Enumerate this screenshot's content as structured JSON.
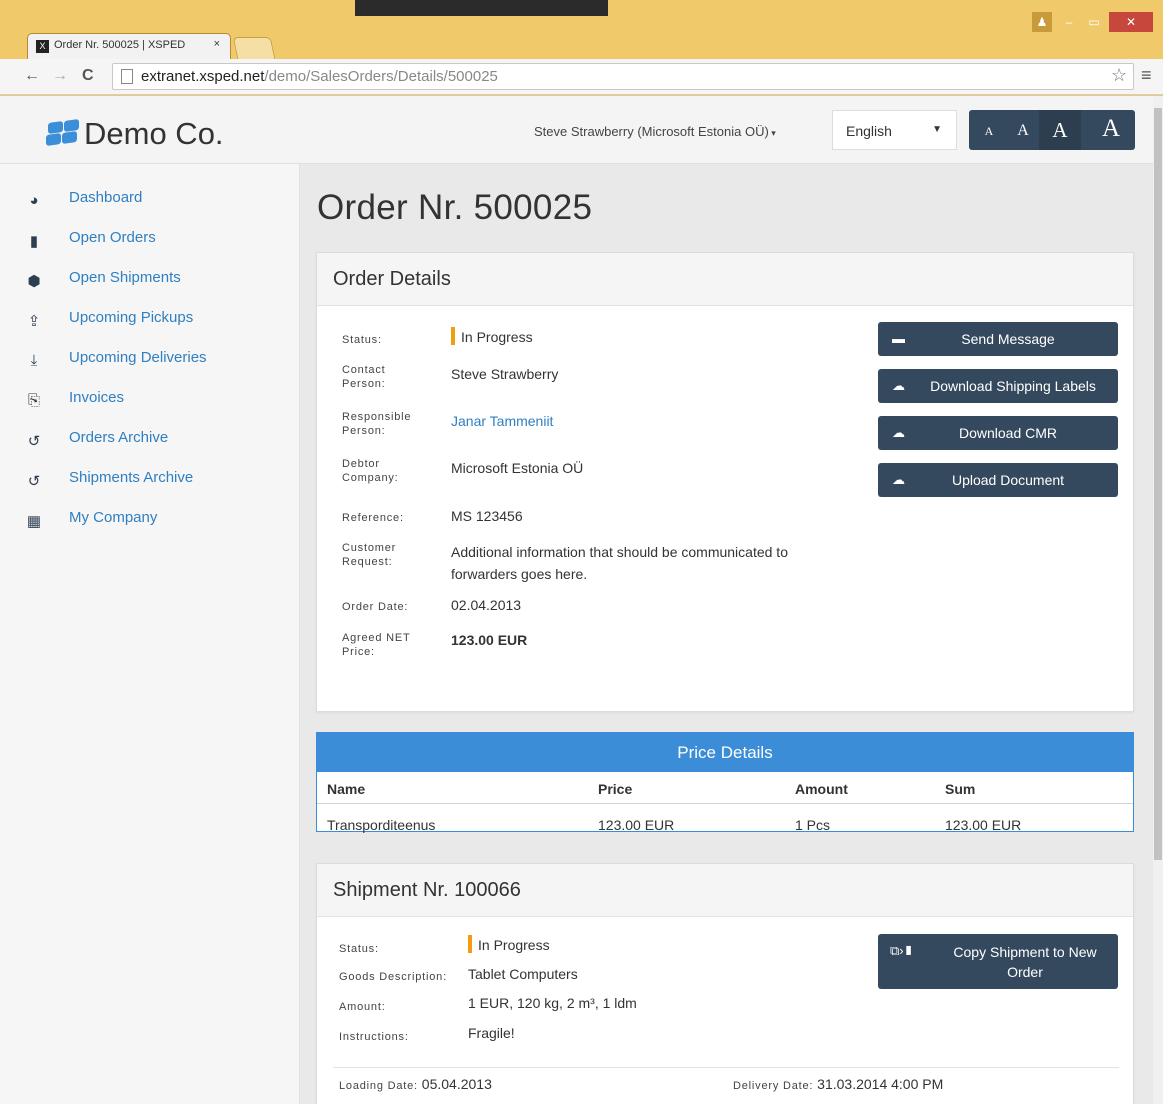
{
  "browser": {
    "tab_title": "Order Nr. 500025 | XSPED",
    "tab_close": "×",
    "url_host": "extranet.xsped.net",
    "url_path": "/demo/SalesOrders/Details/500025"
  },
  "header": {
    "brand": "Demo Co.",
    "user": "Steve Strawberry (Microsoft Estonia OÜ)",
    "language": "English",
    "font_sizes": [
      "A",
      "A",
      "A",
      "A"
    ]
  },
  "sidebar": {
    "items": [
      {
        "label": "Dashboard",
        "icon": "dashboard-icon"
      },
      {
        "label": "Open Orders",
        "icon": "file-icon"
      },
      {
        "label": "Open Shipments",
        "icon": "box-icon"
      },
      {
        "label": "Upcoming Pickups",
        "icon": "upload-icon"
      },
      {
        "label": "Upcoming Deliveries",
        "icon": "download-icon"
      },
      {
        "label": "Invoices",
        "icon": "pdf-icon"
      },
      {
        "label": "Orders Archive",
        "icon": "history-icon"
      },
      {
        "label": "Shipments Archive",
        "icon": "history-icon"
      },
      {
        "label": "My Company",
        "icon": "building-icon"
      }
    ]
  },
  "page_title": "Order Nr. 500025",
  "order": {
    "heading": "Order Details",
    "status_label": "Status:",
    "status": "In Progress",
    "contact_label": "Contact Person:",
    "contact": "Steve Strawberry",
    "responsible_label": "Responsible Person:",
    "responsible": "Janar Tammeniit",
    "debtor_label": "Debtor Company:",
    "debtor": "Microsoft Estonia OÜ",
    "reference_label": "Reference:",
    "reference": "MS 123456",
    "request_label": "Customer Request:",
    "request": "Additional information that should be communicated to forwarders goes here.",
    "date_label": "Order Date:",
    "date": "02.04.2013",
    "price_label": "Agreed NET Price:",
    "price": "123.00 EUR",
    "buttons": {
      "send": "Send Message",
      "labels": "Download Shipping Labels",
      "cmr": "Download CMR",
      "upload": "Upload Document"
    }
  },
  "price_details": {
    "title": "Price Details",
    "columns": [
      "Name",
      "Price",
      "Amount",
      "Sum"
    ],
    "rows": [
      [
        "Transporditeenus",
        "123.00 EUR",
        "1 Pcs",
        "123.00 EUR"
      ]
    ]
  },
  "shipment": {
    "heading": "Shipment Nr. 100066",
    "status_label": "Status:",
    "status": "In Progress",
    "goods_label": "Goods Description:",
    "goods": "Tablet Computers",
    "amount_label": "Amount:",
    "amount": "1 EUR, 120 kg, 2 m³, 1 ldm",
    "instructions_label": "Instructions:",
    "instructions": "Fragile!",
    "copy_button": "Copy Shipment to New Order",
    "loading_label": "Loading Date:",
    "loading": "05.04.2013",
    "delivery_label": "Delivery Date:",
    "delivery": "31.03.2014 4:00 PM"
  },
  "colors": {
    "accent": "#3a8dd6",
    "button": "#34495e",
    "status": "#f39c12",
    "link": "#2f7fc1"
  }
}
